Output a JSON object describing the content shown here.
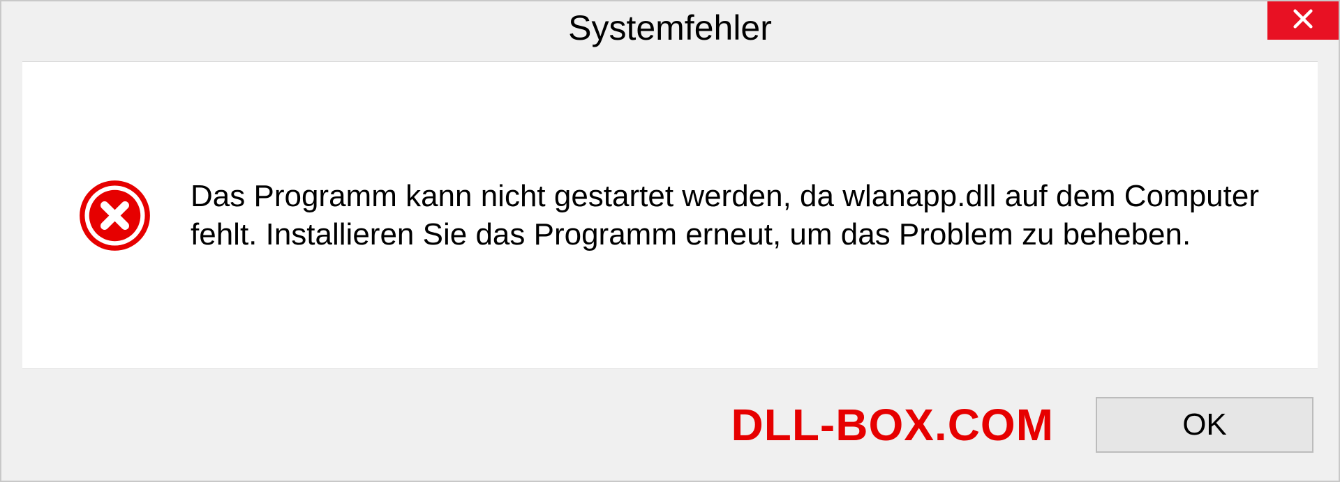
{
  "dialog": {
    "title": "Systemfehler",
    "message": "Das Programm kann nicht gestartet werden, da wlanapp.dll auf dem Computer fehlt. Installieren Sie das Programm erneut, um das Problem zu beheben.",
    "ok_label": "OK"
  },
  "watermark": "DLL-BOX.COM"
}
